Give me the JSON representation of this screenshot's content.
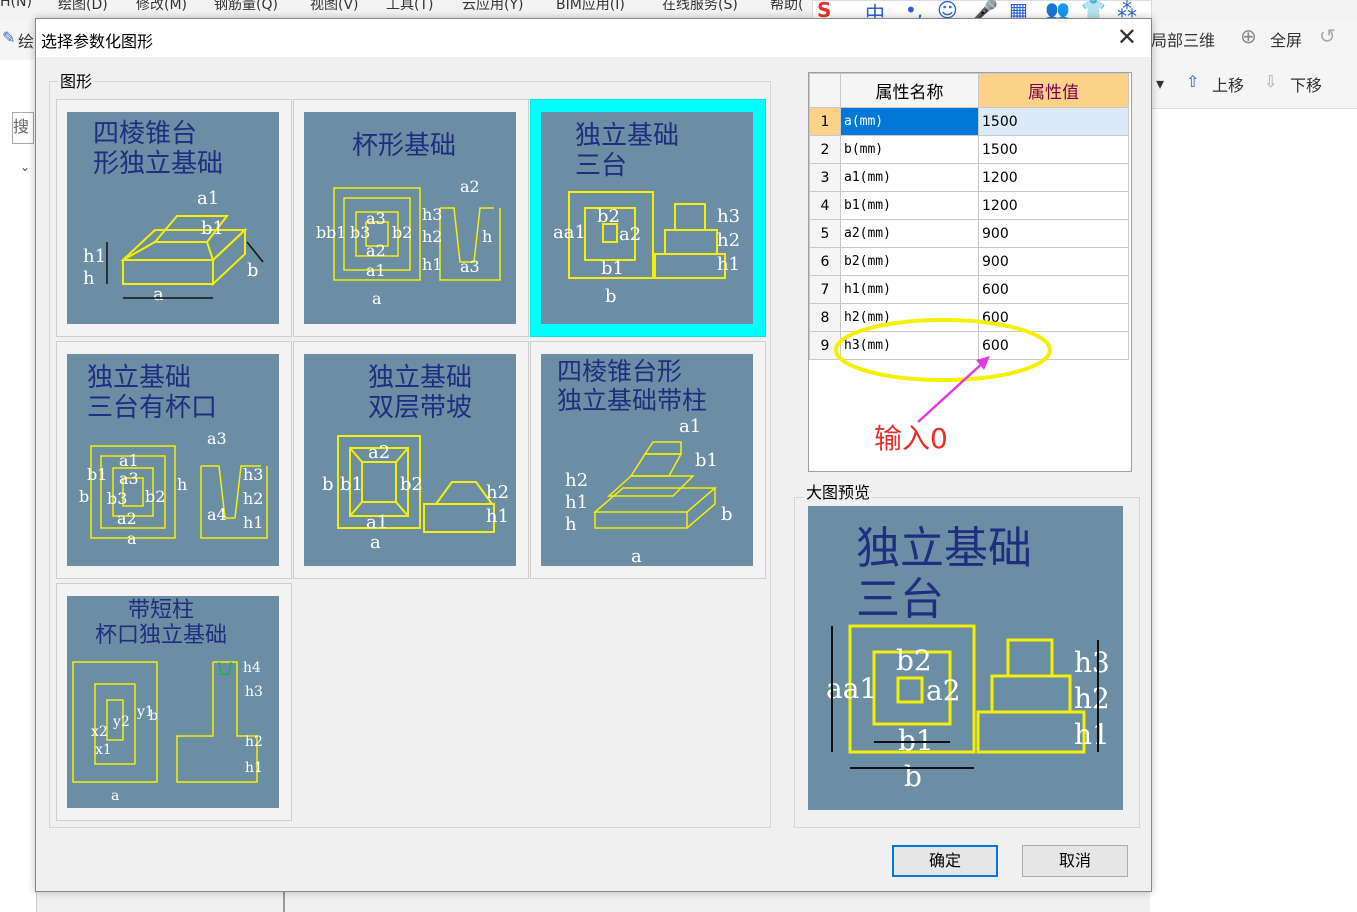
{
  "app": {
    "menu": [
      "H(N)",
      "绘图(D)",
      "修改(M)",
      "钢筋量(Q)",
      "视图(V)",
      "工具(T)",
      "云应用(Y)",
      "BIM应用(I)",
      "在线服务(S)",
      "帮助("
    ],
    "toolbar": {
      "local3d": "局部三维",
      "fullscreen": "全屏",
      "move_up": "上移",
      "move_down": "下移",
      "search": "搜",
      "left_label": "绘"
    },
    "ime": [
      "S",
      "中",
      "•,",
      "☺",
      "🎤",
      "▦",
      "👥",
      "👕",
      "⁂"
    ]
  },
  "dialog": {
    "title": "选择参数化图形",
    "close": "✕",
    "shapes_group_label": "图形",
    "preview_group_label": "大图预览",
    "ok_label": "确定",
    "cancel_label": "取消"
  },
  "tiles": [
    {
      "title": "四棱锥台\n形独立基础",
      "selected": false
    },
    {
      "title": "杯形基础",
      "selected": false
    },
    {
      "title": "独立基础\n三台",
      "selected": true
    },
    {
      "title": "独立基础\n三台有杯口",
      "selected": false
    },
    {
      "title": "独立基础\n双层带坡",
      "selected": false
    },
    {
      "title": "四棱锥台形\n独立基础带柱",
      "selected": false
    },
    {
      "title": "带短柱\n杯口独立基础",
      "selected": false
    }
  ],
  "property_grid": {
    "headers": {
      "num": "",
      "name": "属性名称",
      "value": "属性值"
    },
    "rows": [
      {
        "num": "1",
        "name": "a(mm)",
        "value": "1500"
      },
      {
        "num": "2",
        "name": "b(mm)",
        "value": "1500"
      },
      {
        "num": "3",
        "name": "a1(mm)",
        "value": "1200"
      },
      {
        "num": "4",
        "name": "b1(mm)",
        "value": "1200"
      },
      {
        "num": "5",
        "name": "a2(mm)",
        "value": "900"
      },
      {
        "num": "6",
        "name": "b2(mm)",
        "value": "900"
      },
      {
        "num": "7",
        "name": "h1(mm)",
        "value": "600"
      },
      {
        "num": "8",
        "name": "h2(mm)",
        "value": "600"
      },
      {
        "num": "9",
        "name": "h3(mm)",
        "value": "600"
      }
    ]
  },
  "preview": {
    "title": "独立基础\n三台"
  },
  "annotation": {
    "text": "输入0",
    "color": "#e8302a",
    "ellipse_color": "#f5f000",
    "arrow_color": "#e03ce0"
  },
  "colors": {
    "diagram_bg": "#6b8ea5",
    "line": "#f5f000",
    "title": "#1f2f80",
    "label": "#ffffff",
    "selected_border": "#00ffff"
  }
}
